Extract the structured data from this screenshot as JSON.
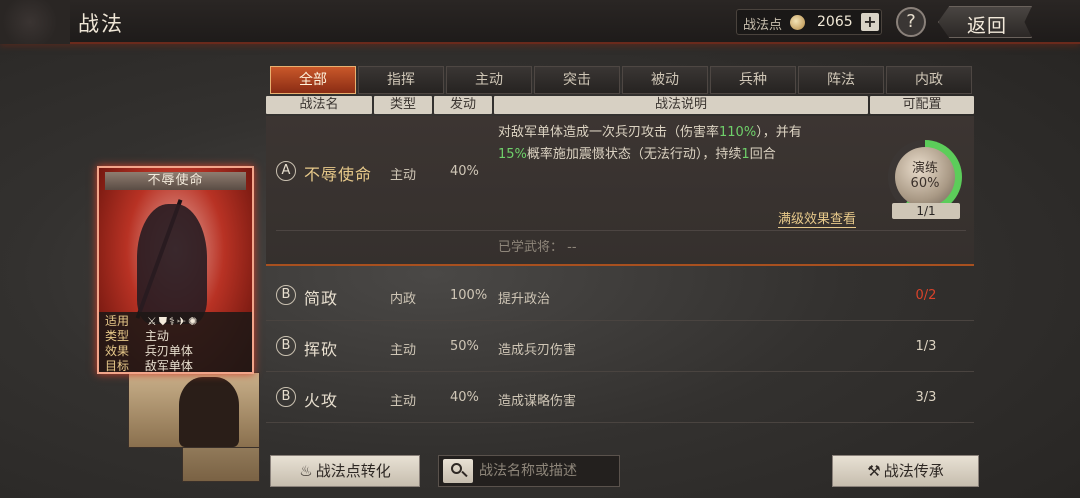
{
  "header": {
    "title": "战法",
    "points_label": "战法点",
    "points_value": "2065",
    "plus_label": "+",
    "help_label": "?",
    "back_label": "返回"
  },
  "tabs": [
    "全部",
    "指挥",
    "主动",
    "突击",
    "被动",
    "兵种",
    "阵法",
    "内政"
  ],
  "columns": [
    "战法名",
    "类型",
    "发动",
    "战法说明",
    "可配置"
  ],
  "expanded_skill": {
    "grade": "A",
    "name": "不辱使命",
    "type": "主动",
    "rate": "40%",
    "desc_part1": "对敌军单体造成一次兵刃攻击（伤害率",
    "desc_hl1": "110%",
    "desc_part2": "），并有",
    "desc_hl2": "15%",
    "desc_part3": "概率施加震慑状态（无法行动），持续",
    "desc_hl3": "1",
    "desc_part4": "回合",
    "full_effect_link": "满级效果查看",
    "learned_label": "已学武将：",
    "learned_value": "--",
    "train_label": "演练",
    "train_percent": "60%",
    "train_progress": 0.6,
    "train_count": "1/1"
  },
  "skills": [
    {
      "grade": "B",
      "name": "简政",
      "type": "内政",
      "rate": "100%",
      "desc": "提升政治",
      "config": "0/2"
    },
    {
      "grade": "B",
      "name": "挥砍",
      "type": "主动",
      "rate": "50%",
      "desc": "造成兵刃伤害",
      "config": "1/3"
    },
    {
      "grade": "B",
      "name": "火攻",
      "type": "主动",
      "rate": "40%",
      "desc": "造成谋略伤害",
      "config": "3/3"
    }
  ],
  "card": {
    "title": "不辱使命",
    "arms_label": "适用",
    "arms_icons": "⚔⛊⚕✈✺",
    "type_label": "类型",
    "type_value": "主动",
    "effect_label": "效果",
    "effect_value": "兵刃单体",
    "target_label": "目标",
    "target_value": "敌军单体"
  },
  "footer": {
    "convert_label": "战法点转化",
    "search_placeholder": "战法名称或描述",
    "inherit_label": "战法传承"
  },
  "colors": {
    "accent": "#c9582a",
    "highlight_green": "#6fd06a",
    "gold": "#e7c98a",
    "warn_red": "#d8422a"
  }
}
